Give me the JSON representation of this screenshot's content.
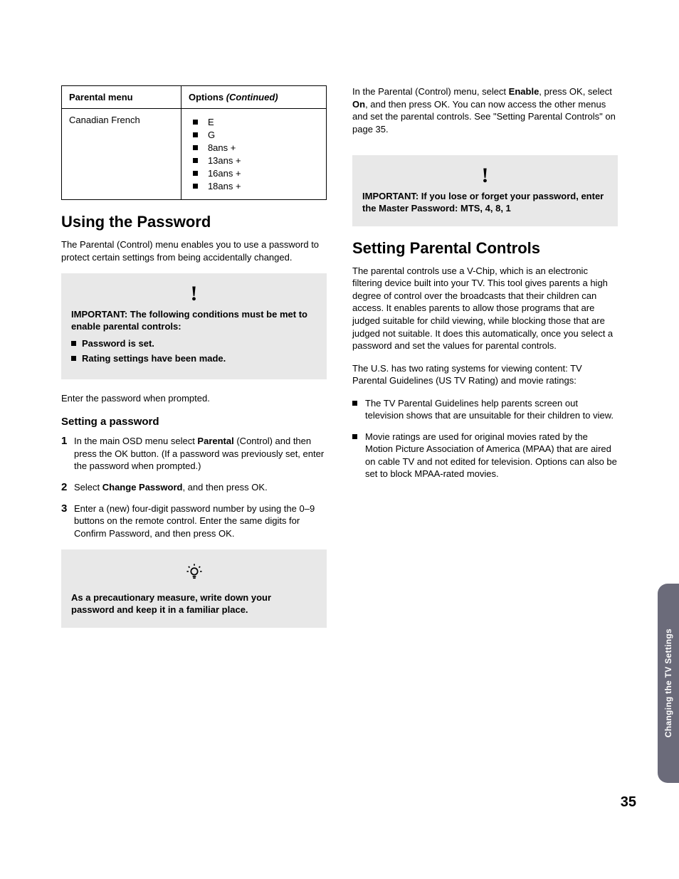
{
  "table": {
    "headers": {
      "col1": "Parental menu",
      "col2_pre": "Options",
      "col2_suf": "(Continued)"
    },
    "row_label": "Canadian French",
    "options": [
      "E",
      "G",
      "8ans +",
      "13ans +",
      "16ans +",
      "18ans +"
    ]
  },
  "left": {
    "h2": "Using the Password",
    "p1": "The Parental (Control) menu enables you to use a password to protect certain settings from being accidentally changed.",
    "callout1": {
      "lead": "IMPORTANT: The following conditions must be met to enable parental controls:",
      "items": [
        "Password is set.",
        "Rating settings have been made."
      ]
    },
    "p2": "Enter the password when prompted.",
    "h3": "Setting a password",
    "steps": {
      "s1_pre": "In the main OSD menu select ",
      "s1_b": "Parental",
      "s1_post": " (Control) and then press the OK button. (If a password was previously set, enter the password when prompted.)",
      "s2_pre": "Select ",
      "s2_b": "Change Password",
      "s2_post": ", and then press OK.",
      "s3": "Enter a (new) four-digit password number by using the 0–9 buttons on the remote control. Enter the same digits for Confirm Password, and then press OK."
    },
    "callout2": "As a precautionary measure, write down your password and keep it in a familiar place."
  },
  "right": {
    "p1_pre": "In the Parental (Control) menu, select ",
    "p1_b1": "Enable",
    "p1_mid": ", press OK, select ",
    "p1_b2": "On",
    "p1_post": ", and then press OK. You can now access the other menus and set the parental controls. See \"Setting Parental Controls\" on page 35.",
    "callout": "IMPORTANT: If you lose or forget your password, enter the Master Password: MTS, 4, 8, 1",
    "h2": "Setting Parental Controls",
    "p2": "The parental controls use a V-Chip, which is an electronic filtering device built into your TV. This tool gives parents a high degree of control over the broadcasts that their children can access. It enables parents to allow those programs that are judged suitable for child viewing, while blocking those that are judged not suitable. It does this automatically, once you select a password and set the values for parental controls.",
    "p3": "The U.S. has two rating systems for viewing content: TV Parental Guidelines (US TV Rating) and movie ratings:",
    "bullets": [
      "The TV Parental Guidelines help parents screen out television shows that are unsuitable for their children to view.",
      "Movie ratings are used for original movies rated by the Motion Picture Association of America (MPAA) that are aired on cable TV and not edited for television. Options can also be set to block MPAA-rated movies."
    ]
  },
  "side_tab": "Changing the TV Settings",
  "page_number": "35"
}
